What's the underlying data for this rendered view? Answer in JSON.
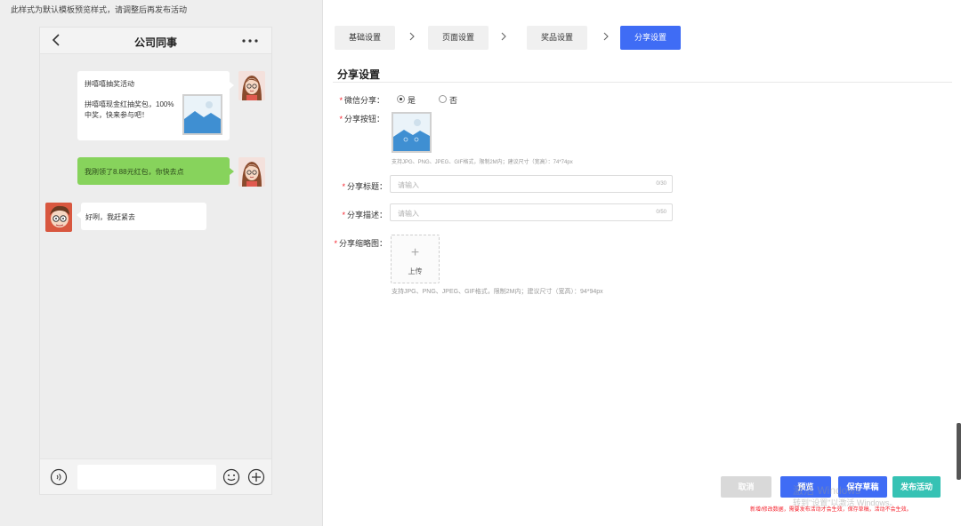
{
  "preview": {
    "notice": "此样式为默认模板预览样式，请调整后再发布活动",
    "phone": {
      "title": "公司同事",
      "card": {
        "title": "拼嘻嘻抽奖活动",
        "body": "拼嘻嘻现金红抽奖包，100%中奖，快来参与吧！"
      },
      "green_message": "我刚领了8.88元红包，你快去点",
      "reply_message": "好咧，我赶紧去"
    }
  },
  "steps": [
    "基础设置",
    "页面设置",
    "奖品设置",
    "分享设置"
  ],
  "active_step": "分享设置",
  "form": {
    "section_title": "分享设置",
    "wechat_share": {
      "label": "微信分享：",
      "options": [
        "是",
        "否"
      ],
      "selected": "是"
    },
    "share_button": {
      "label": "分享按钮：",
      "hint": "支持JPG、PNG、JPEG、GIF格式，限制2M内；建议尺寸（宽高）：74*74px"
    },
    "share_title": {
      "label": "分享标题：",
      "placeholder": "请输入",
      "counter": "0/30"
    },
    "share_desc": {
      "label": "分享描述：",
      "placeholder": "请输入",
      "counter": "0/50"
    },
    "share_thumb": {
      "label": "分享缩略图：",
      "upload_label": "上传",
      "hint": "支持JPG、PNG、JPEG、GIF格式，限制2M内；建议尺寸（宽高）：94*94px"
    }
  },
  "actions": {
    "cancel": "取消",
    "preview": "预览",
    "save_draft": "保存草稿",
    "publish": "发布活动",
    "footnote": "新增/修改数据，需要发布活动才会生效，保存草稿，活动不会生效。"
  },
  "watermark": {
    "line1": "激活 Windows",
    "line2": "转到\"设置\"以激活 Windows。"
  },
  "colors": {
    "primary": "#3f6cf5",
    "publish": "#36c2b4",
    "cancel": "#d9d9d9",
    "green_bubble": "#87d35c",
    "required": "#f5222d"
  }
}
